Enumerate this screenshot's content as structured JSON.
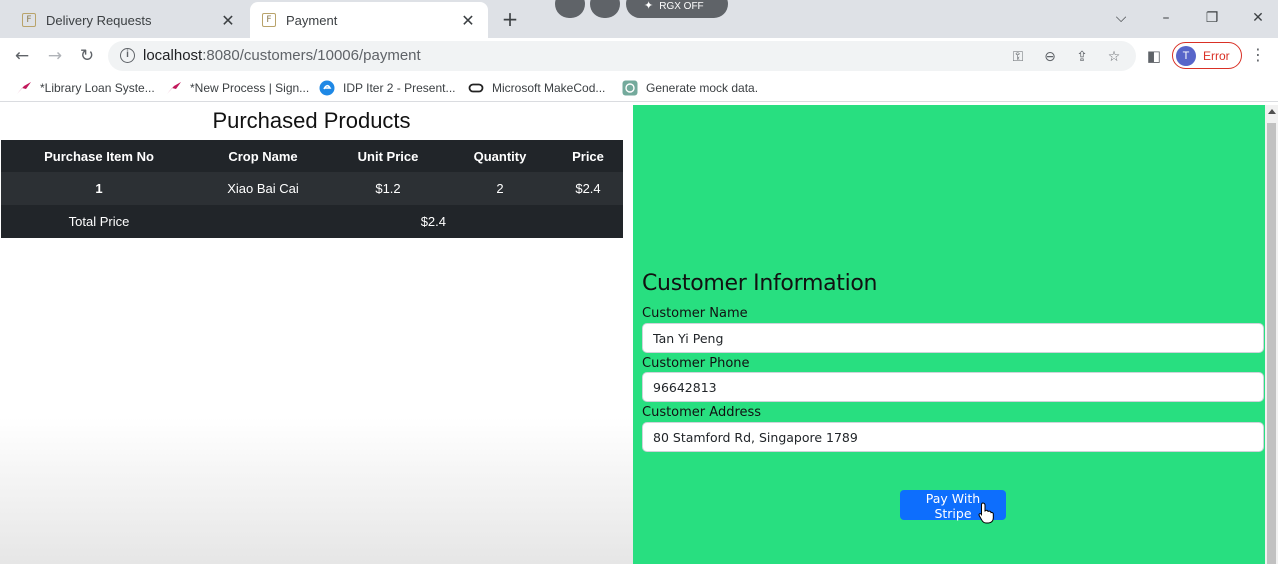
{
  "browser": {
    "tabs": [
      {
        "label": "Delivery Requests",
        "favicon": "F",
        "active": false
      },
      {
        "label": "Payment",
        "favicon": "F",
        "active": true
      }
    ],
    "extension_label": "RGX OFF",
    "url_host": "localhost",
    "url_path": ":8080/customers/10006/payment",
    "profile": {
      "initial": "T",
      "status": "Error"
    },
    "bookmarks": [
      "*Library Loan Syste...",
      "*New Process | Sign...",
      "IDP Iter 2 - Present...",
      "Microsoft MakeCod...",
      "Generate mock data."
    ]
  },
  "products": {
    "heading": "Purchased Products",
    "columns": [
      "Purchase Item No",
      "Crop Name",
      "Unit Price",
      "Quantity",
      "Price"
    ],
    "rows": [
      {
        "no": "1",
        "crop": "Xiao Bai Cai",
        "unit_price": "$1.2",
        "quantity": "2",
        "price": "$2.4"
      }
    ],
    "total_label": "Total Price",
    "total_value": "$2.4"
  },
  "customer": {
    "heading": "Customer Information",
    "name_label": "Customer Name",
    "name_value": "Tan Yi Peng",
    "phone_label": "Customer Phone",
    "phone_value": "96642813",
    "address_label": "Customer Address",
    "address_value": "80 Stamford Rd, Singapore 1789",
    "pay_button": "Pay With Stripe"
  },
  "colors": {
    "panel_green": "#28df80",
    "table_dark": "#212529",
    "pay_blue": "#0d6efd",
    "profile_error": "#d93025"
  }
}
